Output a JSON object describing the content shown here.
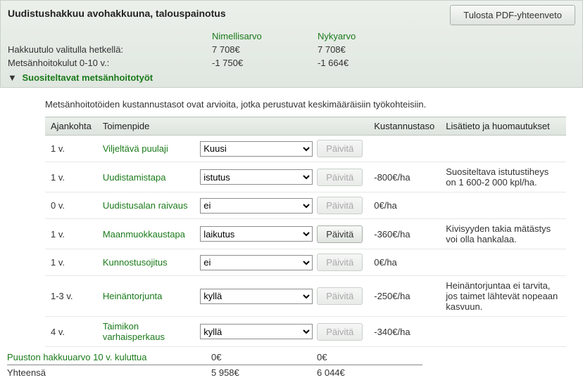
{
  "header": {
    "title": "Uudistushakkuu avohakkuuna, talouspainotus",
    "pdf_button": "Tulosta PDF-yhteenveto"
  },
  "summary": {
    "col_nominal": "Nimellisarvo",
    "col_present": "Nykyarvo",
    "row1_label": "Hakkuutulo valitulla hetkellä:",
    "row1_nominal": "7 708€",
    "row1_present": "7 708€",
    "row2_label": "Metsänhoitokulut 0-10 v.:",
    "row2_nominal": "-1 750€",
    "row2_present": "-1 664€"
  },
  "section": {
    "toggle_label": "Suositeltavat metsänhoitotyöt",
    "intro": "Metsänhoitotöiden kustannustasot ovat arvioita, jotka perustuvat keskimääräisiin työkohteisiin."
  },
  "table": {
    "cols": {
      "time": "Ajankohta",
      "action": "Toimenpide",
      "cost": "Kustannustaso",
      "note": "Lisätieto ja huomautukset"
    },
    "update_label": "Päivitä",
    "rows": [
      {
        "time": "1 v.",
        "name": "Viljeltävä puulaji",
        "value": "Kuusi",
        "cost": "",
        "note": "",
        "enabled": false
      },
      {
        "time": "1 v.",
        "name": "Uudistamistapa",
        "value": "istutus",
        "cost": "-800€/ha",
        "note": "Suositeltava istutustiheys on 1 600-2 000 kpl/ha.",
        "enabled": false
      },
      {
        "time": "0 v.",
        "name": "Uudistusalan raivaus",
        "value": "ei",
        "cost": "0€/ha",
        "note": "",
        "enabled": false
      },
      {
        "time": "1 v.",
        "name": "Maanmuokkaustapa",
        "value": "laikutus",
        "cost": "-360€/ha",
        "note": "Kivisyyden takia mätästys voi olla hankalaa.",
        "enabled": true
      },
      {
        "time": "1 v.",
        "name": "Kunnostusojitus",
        "value": "ei",
        "cost": "0€/ha",
        "note": "",
        "enabled": false
      },
      {
        "time": "1-3 v.",
        "name": "Heinäntorjunta",
        "value": "kyllä",
        "cost": "-250€/ha",
        "note": "Heinäntorjuntaa ei tarvita, jos taimet lähtevät nopeaan kasvuun.",
        "enabled": false
      },
      {
        "time": "4 v.",
        "name": "Taimikon varhaisperkaus",
        "value": "kyllä",
        "cost": "-340€/ha",
        "note": "",
        "enabled": false
      }
    ]
  },
  "totals": {
    "row1_label": "Puuston hakkuuarvo 10 v. kuluttua",
    "row1_nominal": "0€",
    "row1_present": "0€",
    "row2_label": "Yhteensä",
    "row2_nominal": "5 958€",
    "row2_present": "6 044€"
  }
}
